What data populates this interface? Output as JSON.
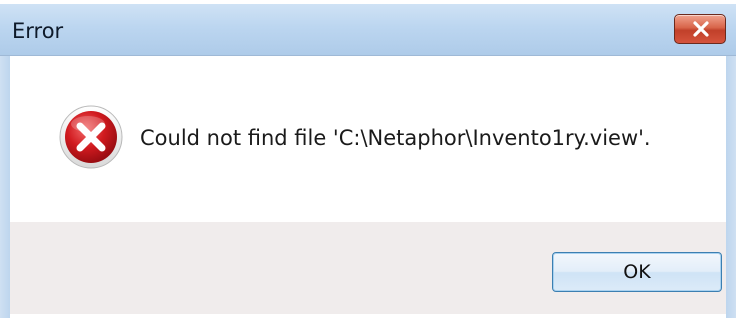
{
  "window": {
    "title": "Error",
    "close_icon": "close-x-icon"
  },
  "dialog": {
    "icon": "error-icon",
    "message": "Could not find file 'C:\\Netaphor\\Invento1ry.view'."
  },
  "buttons": {
    "ok_label": "OK"
  },
  "colors": {
    "titlebar": "#bcd6f0",
    "close_button": "#c9452f",
    "error_icon": "#c9151b",
    "footer": "#f0ecec",
    "ok_border": "#3c7fb1"
  }
}
